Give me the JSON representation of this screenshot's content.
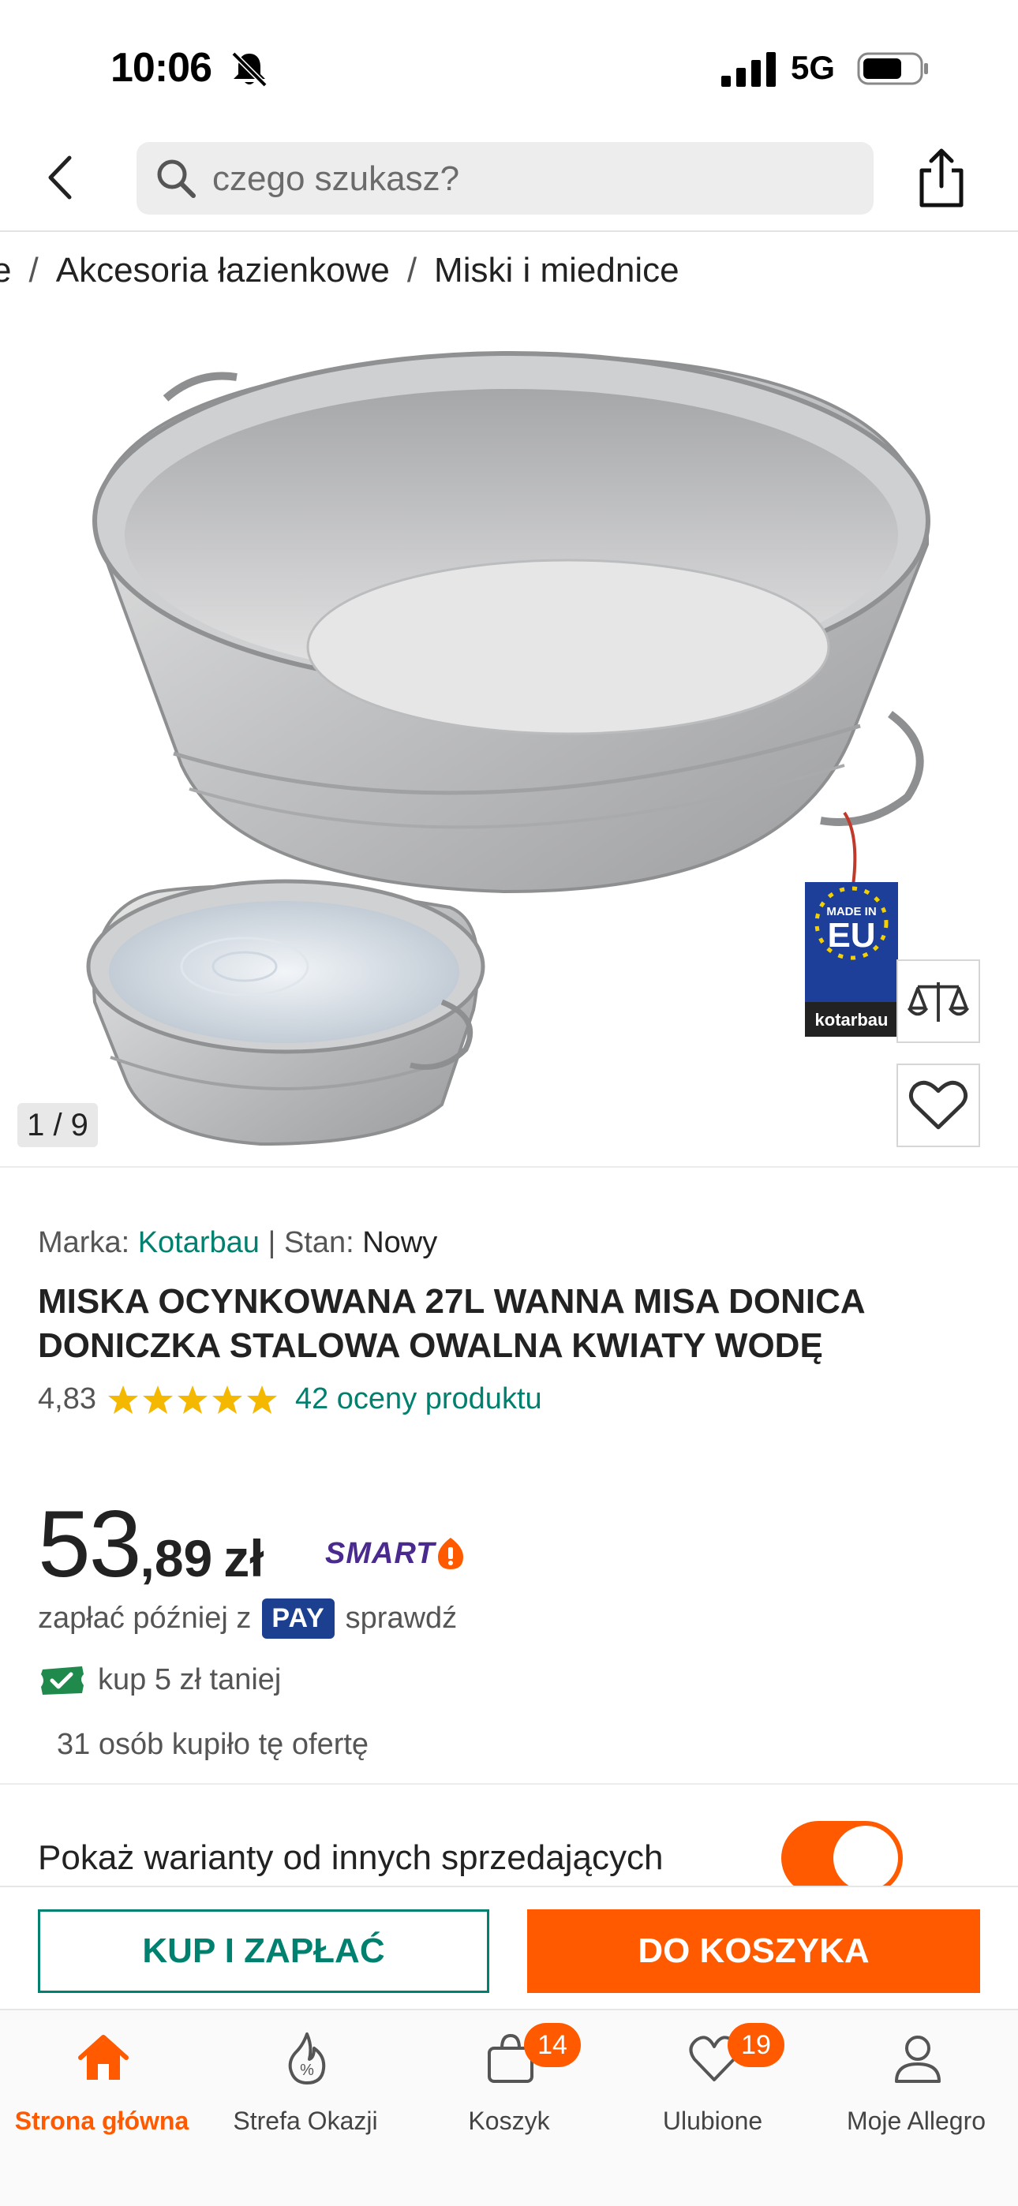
{
  "status_bar": {
    "time": "10:06",
    "network": "5G"
  },
  "nav": {
    "search_placeholder": "czego szukasz?"
  },
  "breadcrumb": {
    "items": [
      "e",
      "Akcesoria łazienkowe",
      "Miski i miednice"
    ],
    "separator": "/"
  },
  "gallery": {
    "counter": "1 / 9",
    "badge_made_in": "MADE IN",
    "badge_eu": "EU",
    "badge_brand": "kotarbau"
  },
  "product": {
    "brand_label": "Marka:",
    "brand": "Kotarbau",
    "divider": "|",
    "condition_label": "Stan:",
    "condition": "Nowy",
    "title": "MISKA OCYNKOWANA 27L WANNA MISA DONICA DONICZKA STALOWA OWALNA KWIATY WODĘ",
    "rating_value": "4,83",
    "stars": 5,
    "rating_count_text": "42 oceny produktu",
    "price_int": "53",
    "price_dec": ",89",
    "currency": "zł",
    "smart_label": "SMART",
    "pay_later_prefix": "zapłać później z",
    "pay_badge": "PAY",
    "pay_later_link": "sprawdź",
    "coupon_text": "kup 5 zł taniej",
    "bought_text": "31 osób kupiło tę ofertę",
    "variants_label": "Pokaż warianty od innych sprzedających",
    "variants_toggle_on": true
  },
  "actions": {
    "buy_now": "KUP I ZAPŁAĆ",
    "add_to_cart": "DO KOSZYKA"
  },
  "tab_bar": {
    "items": [
      {
        "label": "Strona główna",
        "icon": "home-icon",
        "active": true
      },
      {
        "label": "Strefa Okazji",
        "icon": "flame-percent-icon"
      },
      {
        "label": "Koszyk",
        "icon": "cart-bag-icon",
        "badge": "14"
      },
      {
        "label": "Ulubione",
        "icon": "heart-icon",
        "badge": "19"
      },
      {
        "label": "Moje Allegro",
        "icon": "user-icon"
      }
    ]
  },
  "colors": {
    "accent_orange": "#ff5a00",
    "accent_teal": "#00806f",
    "smart_purple": "#4b2a8f",
    "pay_blue": "#1d3f8f",
    "star_yellow": "#f5b800"
  }
}
